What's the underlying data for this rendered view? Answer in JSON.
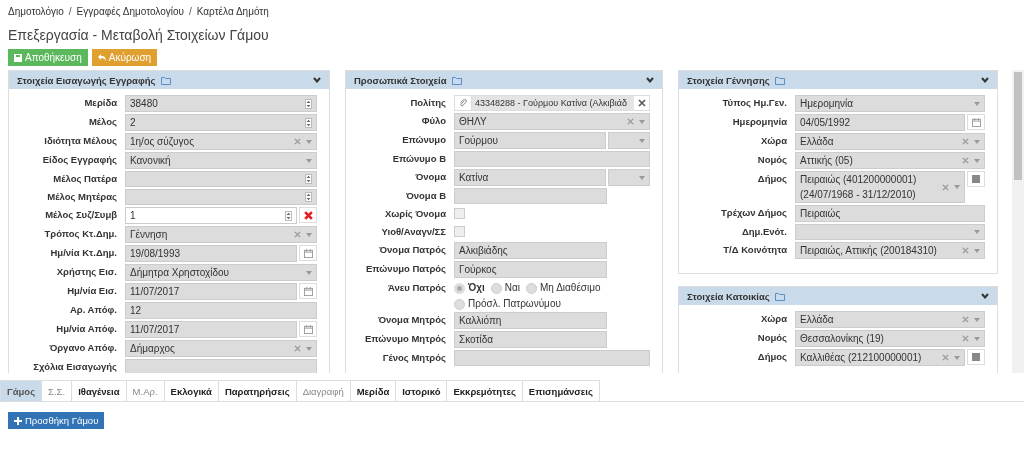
{
  "breadcrumbs": [
    {
      "kind": "link",
      "text": "Δημοτολόγιο"
    },
    {
      "kind": "separator",
      "text": "/"
    },
    {
      "kind": "link",
      "text": "Εγγραφές Δημοτολογίου"
    },
    {
      "kind": "separator",
      "text": "/"
    },
    {
      "kind": "link",
      "text": "Καρτέλα Δημότη"
    }
  ],
  "title": "Επεξεργασία - Μεταβολή Στοιχείων Γάμου",
  "actions": [
    {
      "label": "Αποθήκευση",
      "kind": "save"
    },
    {
      "label": "Ακύρωση",
      "kind": "cancel"
    }
  ],
  "columns": [
    {
      "panels": [
        {
          "title": "Στοιχεία Εισαγωγής Εγγραφής",
          "fields": [
            {
              "label": "Μερίδα",
              "kind": "spinner",
              "value": "38480",
              "disabled": true
            },
            {
              "label": "Μέλος",
              "kind": "spinner",
              "value": "2",
              "disabled": true
            },
            {
              "label": "Ιδιότητα Μέλους",
              "kind": "select",
              "value": "1η/ος σύζυγος",
              "clearable": true,
              "disabled": true
            },
            {
              "label": "Είδος Εγγραφής",
              "kind": "select",
              "value": "Κανονική",
              "clearable": false,
              "disabled": true
            },
            {
              "label": "Μέλος Πατέρα",
              "kind": "spinner",
              "disabled": true
            },
            {
              "label": "Μέλος Μητέρας",
              "kind": "spinner",
              "disabled": true
            },
            {
              "label": "Μέλος Συζ/Συμβ",
              "kind": "spinner",
              "value": "1",
              "disabled": false,
              "remove_button": true
            },
            {
              "label": "Τρόπος Κτ.Δημ.",
              "kind": "select",
              "value": "Γέννηση",
              "clearable": true,
              "disabled": true
            },
            {
              "label": "Ημ/νία Κτ.Δημ.",
              "kind": "date",
              "value": "19/08/1993",
              "disabled": true
            },
            {
              "label": "Χρήστης Εισ.",
              "kind": "select",
              "value": "Δήμητρα Χρηστοχίδου",
              "clearable": false,
              "disabled": true
            },
            {
              "label": "Ημ/νία Εισ.",
              "kind": "date",
              "value": "11/07/2017",
              "disabled": true
            },
            {
              "label": "Αρ. Απόφ.",
              "kind": "text",
              "value": "12",
              "disabled": true
            },
            {
              "label": "Ημ/νία Απόφ.",
              "kind": "date",
              "value": "11/07/2017",
              "disabled": true
            },
            {
              "label": "Όργανο Απόφ.",
              "kind": "select",
              "value": "Δήμαρχος",
              "clearable": true,
              "disabled": true
            },
            {
              "label": "Σχόλια Εισαγωγής",
              "kind": "textarea",
              "disabled": true
            }
          ]
        }
      ]
    },
    {
      "panels": [
        {
          "title": "Προσωπικά Στοιχεία",
          "fields": [
            {
              "label": "Πολίτης",
              "kind": "citizen",
              "value": "43348288 - Γούρμου Κατίνα (Αλκιβιάδ",
              "disabled": true
            },
            {
              "label": "Φύλο",
              "kind": "select",
              "value": "ΘΗΛΥ",
              "clearable": true,
              "disabled": true
            },
            {
              "label": "Επώνυμο",
              "kind": "text-select",
              "value": "Γούρμου",
              "disabled": true
            },
            {
              "label": "Επώνυμο Β",
              "kind": "text",
              "disabled": true
            },
            {
              "label": "Όνομα",
              "kind": "text-select",
              "value": "Κατίνα",
              "disabled": true
            },
            {
              "label": "Όνομα Β",
              "kind": "short-text",
              "disabled": true
            },
            {
              "label": "Χωρίς Όνομα",
              "kind": "checkbox",
              "checked": false,
              "disabled": true
            },
            {
              "label": "Υιοθ/Αναγν/ΣΣ",
              "kind": "checkbox",
              "checked": false,
              "disabled": true
            },
            {
              "label": "Όνομα Πατρός",
              "kind": "short-text",
              "value": "Αλκιβιάδης",
              "disabled": true
            },
            {
              "label": "Επώνυμο Πατρός",
              "kind": "short-text",
              "value": "Γούρκος",
              "disabled": true
            },
            {
              "label": "Άνευ Πατρός",
              "kind": "radio",
              "disabled": true,
              "options": [
                {
                  "label": "Όχι",
                  "selected": true
                },
                {
                  "label": "Ναι",
                  "selected": false
                },
                {
                  "label": "Μη Διαθέσιμο",
                  "selected": false
                },
                {
                  "label": "Πρόσλ. Πατρωνύμου",
                  "selected": false
                }
              ]
            },
            {
              "label": "Όνομα Μητρός",
              "kind": "short-text",
              "value": "Καλλιόπη",
              "disabled": true
            },
            {
              "label": "Επώνυμο Μητρός",
              "kind": "short-text",
              "value": "Σκοτίδα",
              "disabled": true
            },
            {
              "label": "Γένος Μητρός",
              "kind": "text",
              "disabled": true
            }
          ]
        }
      ]
    },
    {
      "panels": [
        {
          "title": "Στοιχεία Γέννησης",
          "fields": [
            {
              "label": "Τύπος Ημ.Γεν.",
              "kind": "select",
              "value": "Ημερομηνία",
              "clearable": false,
              "disabled": true
            },
            {
              "label": "Ημερομηνία",
              "kind": "date",
              "value": "04/05/1992",
              "disabled": true
            },
            {
              "label": "Χώρα",
              "kind": "select",
              "value": "Ελλάδα",
              "clearable": true,
              "disabled": true
            },
            {
              "label": "Νομός",
              "kind": "select",
              "value": "Αττικής (05)",
              "clearable": true,
              "disabled": true
            },
            {
              "label": "Δήμος",
              "kind": "select",
              "value": "Πειραιώς (401200000001)",
              "value_2": "(24/07/1968 - 31/12/2010)",
              "clearable": true,
              "disabled": true,
              "side_button": true
            },
            {
              "label": "Τρέχων Δήμος",
              "kind": "text",
              "value": "Πειραιώς",
              "disabled": true
            },
            {
              "label": "Δημ.Ενότ.",
              "kind": "select",
              "clearable": false,
              "disabled": true
            },
            {
              "label": "Τ/Δ Κοινότητα",
              "kind": "select",
              "value": "Πειραιώς, Αττικής (200184310)",
              "clearable": true,
              "disabled": true
            }
          ]
        },
        {
          "title": "Στοιχεία Κατοικίας",
          "fields": [
            {
              "label": "Χώρα",
              "kind": "select",
              "value": "Ελλάδα",
              "clearable": true,
              "disabled": true
            },
            {
              "label": "Νομός",
              "kind": "select",
              "value": "Θεσσαλονίκης (19)",
              "clearable": true,
              "disabled": true
            },
            {
              "label": "Δήμος",
              "kind": "select",
              "value": "Καλλιθέας (212100000001)",
              "clearable": true,
              "disabled": true,
              "side_button": true
            }
          ]
        }
      ]
    }
  ],
  "tabs": [
    {
      "label": "Γάμος",
      "selected": true,
      "disabled": false
    },
    {
      "label": "Σ.Σ.",
      "selected": false,
      "disabled": true
    },
    {
      "label": "Ιθαγένεια",
      "selected": false,
      "disabled": false
    },
    {
      "label": "Μ.Αρ.",
      "selected": false,
      "disabled": true
    },
    {
      "label": "Εκλογικά",
      "selected": false,
      "disabled": false
    },
    {
      "label": "Παρατηρήσεις",
      "selected": false,
      "disabled": false
    },
    {
      "label": "Διαγραφή",
      "selected": false,
      "disabled": true
    },
    {
      "label": "Μερίδα",
      "selected": false,
      "disabled": false
    },
    {
      "label": "Ιστορικό",
      "selected": false,
      "disabled": false
    },
    {
      "label": "Εκκρεμότητες",
      "selected": false,
      "disabled": false
    },
    {
      "label": "Επισημάνσεις",
      "selected": false,
      "disabled": false
    }
  ],
  "add_button": "Προσθήκη Γάμου"
}
